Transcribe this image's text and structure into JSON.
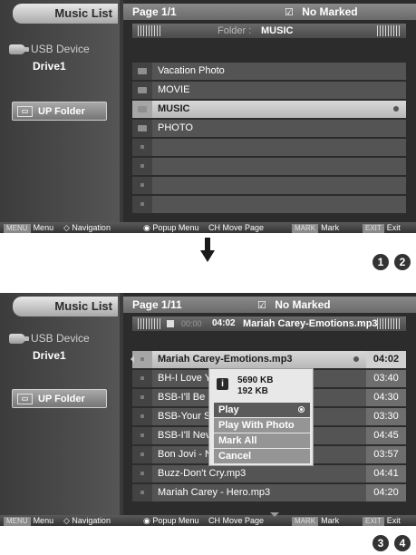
{
  "screen1": {
    "sidebar": {
      "title": "Music List",
      "device_label": "USB Device",
      "drive_label": "Drive1",
      "up_folder_label": "UP Folder"
    },
    "header": {
      "page_label": "Page 1/1",
      "marked_icon": "☑",
      "marked_label": "No Marked"
    },
    "infobar": {
      "folder_prefix": "Folder :",
      "folder_name": "MUSIC"
    },
    "list": [
      {
        "name": "Vacation Photo",
        "icon": "folder-icon"
      },
      {
        "name": "MOVIE",
        "icon": "folder-icon"
      },
      {
        "name": "MUSIC",
        "icon": "folder-icon",
        "selected": true
      },
      {
        "name": "PHOTO",
        "icon": "folder-icon"
      },
      {
        "name": "",
        "icon": "empty-slot"
      },
      {
        "name": "",
        "icon": "empty-slot"
      },
      {
        "name": "",
        "icon": "empty-slot"
      },
      {
        "name": "",
        "icon": "empty-slot"
      }
    ]
  },
  "screen2": {
    "sidebar": {
      "title": "Music List",
      "device_label": "USB Device",
      "drive_label": "Drive1",
      "up_folder_label": "UP Folder"
    },
    "header": {
      "page_label": "Page 1/11",
      "marked_icon": "☑",
      "marked_label": "No Marked"
    },
    "nowplaying": {
      "elapsed": "00:00",
      "length": "04:02",
      "title": "Mariah Carey-Emotions.mp3"
    },
    "list": [
      {
        "name": "Mariah Carey-Emotions.mp3",
        "duration": "04:02",
        "selected": true
      },
      {
        "name": "BH-I Love You.mp3",
        "duration": "03:40"
      },
      {
        "name": "BSB-I'll Be Missing You.mp3",
        "duration": "04:30"
      },
      {
        "name": "BSB-Your Style.mp3",
        "duration": "03:30"
      },
      {
        "name": "BSB-I'll Never Break.mp3",
        "duration": "04:45"
      },
      {
        "name": "Bon Jovi - Never Say.mp3",
        "duration": "03:57"
      },
      {
        "name": "Buzz-Don't Cry.mp3",
        "duration": "04:41"
      },
      {
        "name": "Mariah Carey - Hero.mp3",
        "duration": "04:20"
      }
    ],
    "popup": {
      "info_icon": "i",
      "size_total": "5690 KB",
      "size_used": "192 KB",
      "items": [
        "Play",
        "Play With Photo",
        "Mark All",
        "Cancel"
      ]
    }
  },
  "bottombar": {
    "menu_badge": "MENU",
    "menu_label": "Menu",
    "navigation_label": "Navigation",
    "popup_label": "Popup Menu",
    "ch_badge": "CH",
    "move_page_label": "Move Page",
    "mark_badge": "MARK",
    "mark_label": "Mark",
    "exit_badge": "EXIT",
    "exit_label": "Exit"
  },
  "step_badges": [
    "1",
    "2",
    "3",
    "4"
  ],
  "colors": {
    "screen_bg": "#2c2c2c",
    "selected_row": "#c8c8c8",
    "popup_bg": "#e8e8e8",
    "popup_active_item": "#5a5a5a"
  }
}
